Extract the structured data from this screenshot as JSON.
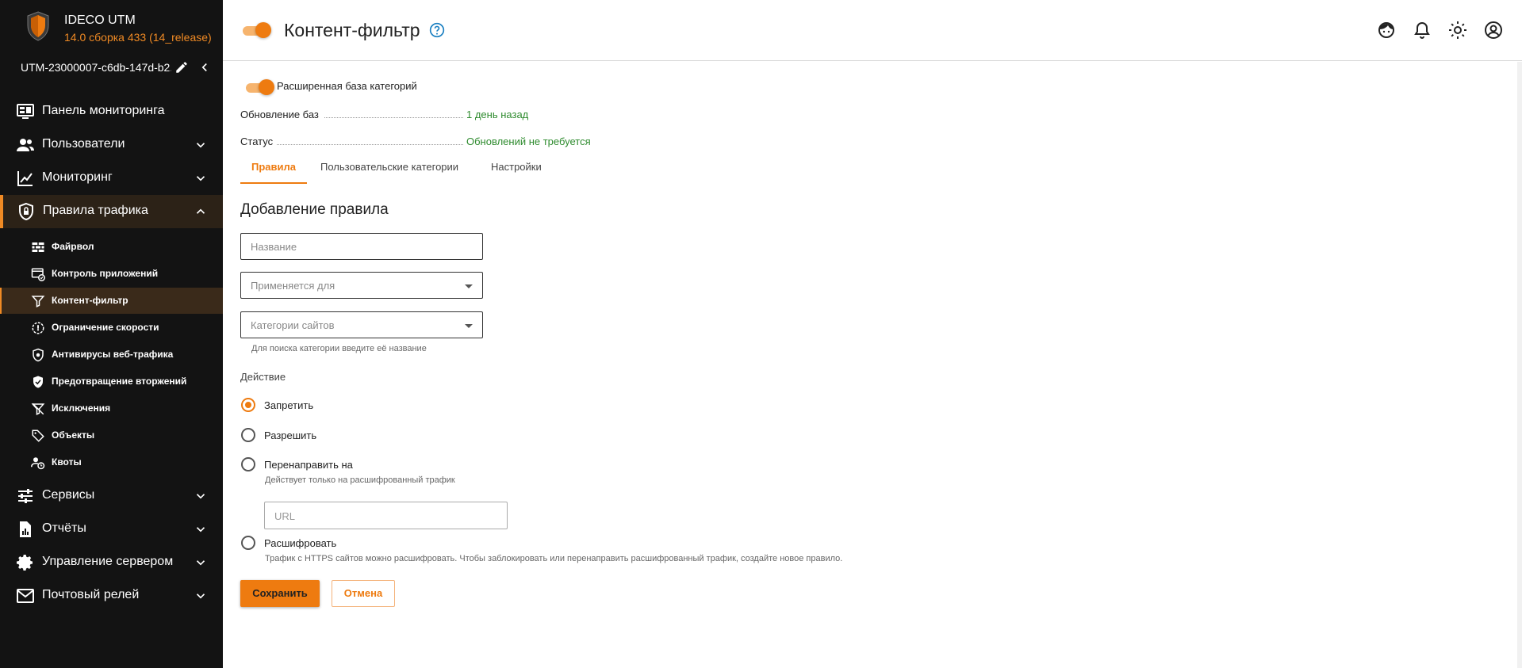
{
  "brand": {
    "name": "IDECO UTM",
    "version": "14.0 сборка 433 (14_release)",
    "accent": "#f08a24"
  },
  "device": {
    "id": "UTM-23000007-c6db-147d-b2..."
  },
  "nav": {
    "dashboard": "Панель мониторинга",
    "users": "Пользователи",
    "monitoring": "Мониторинг",
    "traffic_rules": "Правила трафика",
    "sub": {
      "firewall": "Файрвол",
      "app_control": "Контроль приложений",
      "content_filter": "Контент-фильтр",
      "speed_limit": "Ограничение скорости",
      "antivirus": "Антивирусы веб-трафика",
      "ips": "Предотвращение вторжений",
      "exceptions": "Исключения",
      "objects": "Объекты",
      "quotas": "Квоты"
    },
    "services": "Сервисы",
    "reports": "Отчёты",
    "server_mgmt": "Управление сервером",
    "mail_relay": "Почтовый релей"
  },
  "header": {
    "title": "Контент-фильтр"
  },
  "filter": {
    "extended_db_label": "Расширенная база категорий",
    "db_update_label": "Обновление баз",
    "db_update_value": "1 день назад",
    "status_label": "Статус",
    "status_value": "Обновлений не требуется"
  },
  "tabs": {
    "rules": "Правила",
    "custom_categories": "Пользовательские категории",
    "settings": "Настройки"
  },
  "form": {
    "title": "Добавление правила",
    "name_placeholder": "Название",
    "applies_placeholder": "Применяется для",
    "categories_placeholder": "Категории сайтов",
    "categories_hint": "Для поиска категории введите её название",
    "action_label": "Действие",
    "action_deny": "Запретить",
    "action_allow": "Разрешить",
    "action_redirect": "Перенаправить на",
    "redirect_hint": "Действует только на расшифрованный трафик",
    "url_placeholder": "URL",
    "action_decrypt": "Расшифровать",
    "decrypt_hint": "Трафик с HTTPS сайтов можно расшифровать. Чтобы заблокировать или перенаправить расшифрованный трафик, создайте новое правило.",
    "save": "Сохранить",
    "cancel": "Отмена"
  }
}
